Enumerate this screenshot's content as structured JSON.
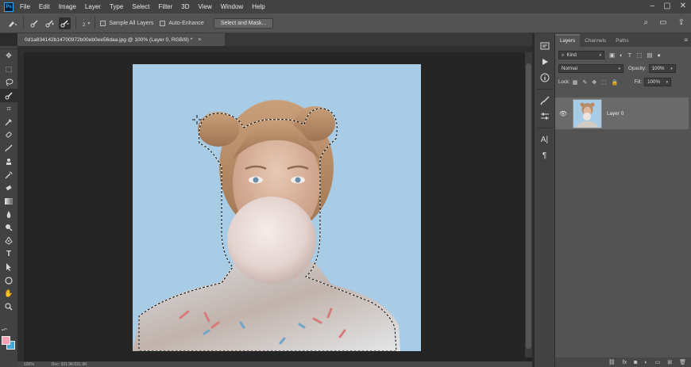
{
  "app": {
    "logo": "Ps",
    "menu": [
      "File",
      "Edit",
      "Image",
      "Layer",
      "Type",
      "Select",
      "Filter",
      "3D",
      "View",
      "Window",
      "Help"
    ]
  },
  "options": {
    "brush_size": "2",
    "sample_all_layers": "Sample All Layers",
    "auto_enhance": "Auto-Enhance",
    "select_and_mask": "Select and Mask..."
  },
  "document": {
    "tab_title": "0d1a834142b14700972b00eb0ee56daa.jpg @ 100% (Layer 0, RGB/8) *",
    "close_glyph": "×"
  },
  "status": {
    "zoom": "100%",
    "doc_info": "Doc: 321.9K/321.9K"
  },
  "panel": {
    "tabs": [
      "Layers",
      "Channels",
      "Paths"
    ],
    "menu_glyph": "≡",
    "kind_filter": "Kind",
    "blend_mode": "Normal",
    "opacity_label": "Opacity:",
    "opacity_value": "100%",
    "lock_label": "Lock:",
    "fill_label": "Fill:",
    "fill_value": "100%",
    "layer_name": "Layer 0"
  },
  "colors": {
    "foreground": "#f4a3b7",
    "background": "#4aa5d9",
    "image_bg": "#a9cce6",
    "accent": "#31a8ff"
  },
  "icons": {
    "toolbar": [
      "move-icon",
      "marquee-icon",
      "lasso-icon",
      "quick-selection-icon",
      "crop-icon",
      "eyedropper-icon",
      "healing-brush-icon",
      "brush-icon",
      "clone-stamp-icon",
      "history-brush-icon",
      "eraser-icon",
      "gradient-icon",
      "blur-icon",
      "dodge-icon",
      "pen-icon",
      "type-icon",
      "path-selection-icon",
      "shape-icon",
      "hand-icon",
      "zoom-icon"
    ]
  }
}
